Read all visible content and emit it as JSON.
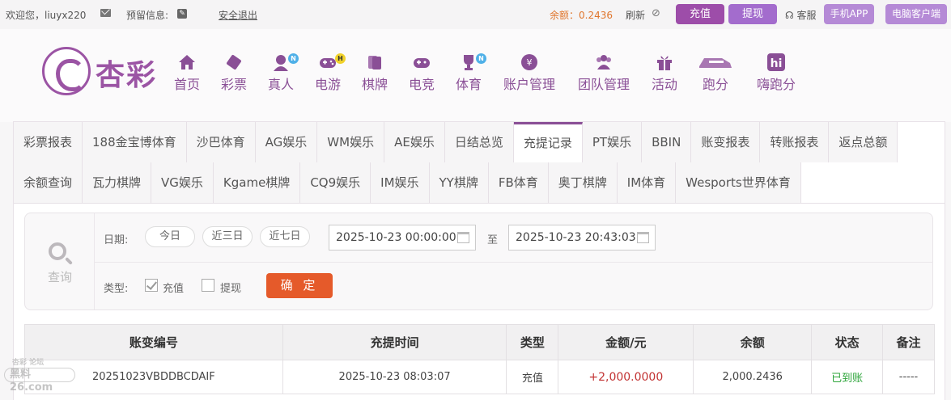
{
  "topbar": {
    "welcome": "欢迎您，liuyx220",
    "reserve_label": "预留信息:",
    "logout": "安全退出",
    "balance": "余额：0.2436",
    "refresh": "刷新",
    "recharge": "充值",
    "withdraw": "提现",
    "service": "客服",
    "mobile_app": "手机APP",
    "pc_client": "电脑客户端"
  },
  "logo": {
    "text": "杏彩"
  },
  "nav": [
    {
      "label": "首页",
      "icon": "home-icon"
    },
    {
      "label": "彩票",
      "icon": "lottery-ticket-icon"
    },
    {
      "label": "真人",
      "icon": "live-dealer-icon",
      "badge": "N"
    },
    {
      "label": "电游",
      "icon": "gamepad-icon",
      "badge": "H"
    },
    {
      "label": "棋牌",
      "icon": "cards-icon"
    },
    {
      "label": "电竞",
      "icon": "esports-controller-icon"
    },
    {
      "label": "体育",
      "icon": "trophy-icon",
      "badge": "N"
    },
    {
      "label": "账户管理",
      "icon": "yen-coin-icon"
    },
    {
      "label": "团队管理",
      "icon": "team-icon"
    },
    {
      "label": "活动",
      "icon": "gift-icon"
    },
    {
      "label": "跑分",
      "icon": "running-car-icon"
    },
    {
      "label": "嗨跑分",
      "icon": "hi-icon"
    }
  ],
  "tabs_row1": [
    "彩票报表",
    "188金宝博体育",
    "沙巴体育",
    "AG娱乐",
    "WM娱乐",
    "AE娱乐",
    "日结总览",
    "充提记录",
    "PT娱乐",
    "BBIN",
    "账变报表",
    "转账报表",
    "返点总额"
  ],
  "tabs_row2": [
    "余额查询",
    "瓦力棋牌",
    "VG娱乐",
    "Kgame棋牌",
    "CQ9娱乐",
    "IM娱乐",
    "YY棋牌",
    "FB体育",
    "奥丁棋牌",
    "IM体育",
    "Wesports世界体育"
  ],
  "active_tab": "充提记录",
  "query": {
    "label": "查询",
    "date_label": "日期:",
    "today": "今日",
    "last3": "近三日",
    "last7": "近七日",
    "start": "2025-10-23 00:00:00",
    "to": "至",
    "end": "2025-10-23 20:43:03",
    "type_label": "类型:",
    "type_recharge": "充值",
    "type_withdraw": "提现",
    "confirm": "确 定"
  },
  "table": {
    "headers": [
      "账变编号",
      "充提时间",
      "类型",
      "金额/元",
      "余额",
      "状态",
      "备注"
    ],
    "rows": [
      [
        "20251023VBDDBCDAIF",
        "2025-10-23 08:03:07",
        "充值",
        "+2,000.0000",
        "2,000.2436",
        "已到账",
        "-----"
      ]
    ]
  },
  "watermark": {
    "top": "杏彩 论坛",
    "main": "黑料26.com"
  },
  "colors": {
    "brand": "#8a4f96",
    "confirm": "#e55a2a",
    "amount": "#c23232",
    "status": "#2da53a",
    "balance": "#e0762d"
  }
}
